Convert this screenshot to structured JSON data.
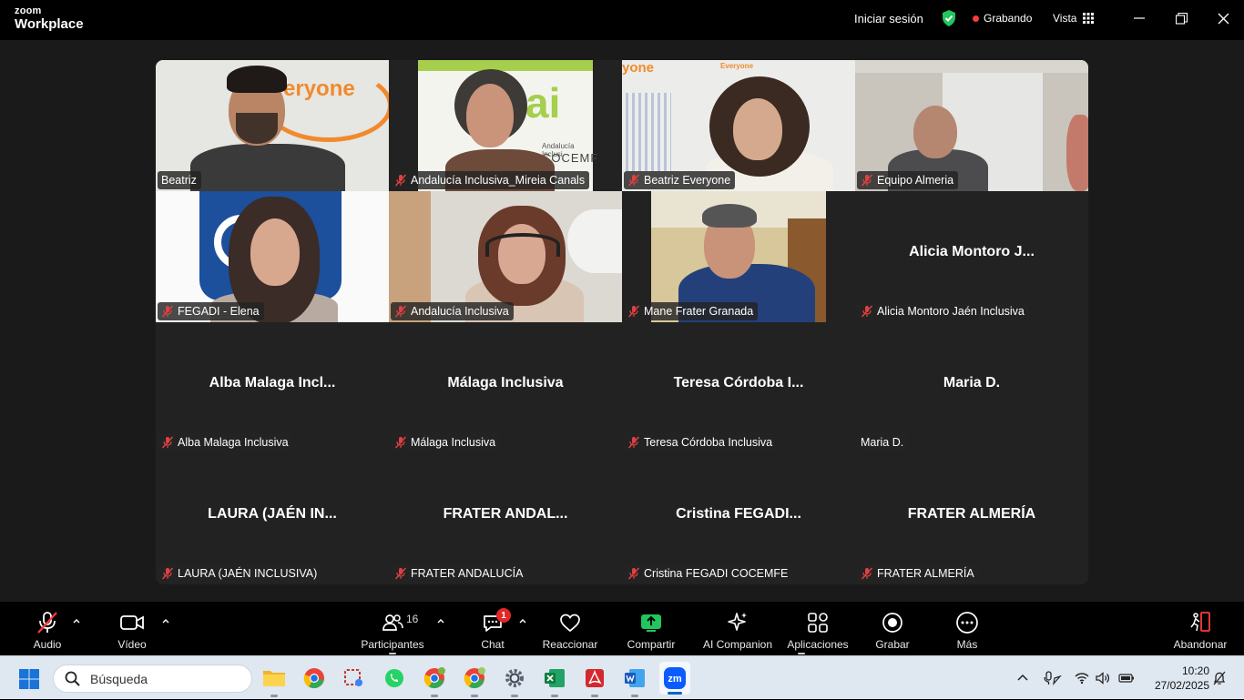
{
  "app": {
    "brand_small": "zoom",
    "brand_large": "Workplace",
    "signin": "Iniciar sesión",
    "recording": "Grabando",
    "view": "Vista"
  },
  "tiles": [
    {
      "name": "Beatriz",
      "big": "",
      "video": true,
      "muted": false,
      "active": true
    },
    {
      "name": "Andalucía Inclusiva_Mireia Canals",
      "big": "",
      "video": true,
      "muted": true
    },
    {
      "name": "Beatriz Everyone",
      "big": "",
      "video": true,
      "muted": true
    },
    {
      "name": "Equipo Almeria",
      "big": "",
      "video": true,
      "muted": true
    },
    {
      "name": "FEGADI - Elena",
      "big": "",
      "video": true,
      "muted": true
    },
    {
      "name": "Andalucía Inclusiva",
      "big": "",
      "video": true,
      "muted": true
    },
    {
      "name": "Mane Frater Granada",
      "big": "",
      "video": true,
      "muted": true
    },
    {
      "name": "Alicia Montoro Jaén Inclusiva",
      "big": "Alicia  Montoro  J...",
      "video": false,
      "muted": true
    },
    {
      "name": "Alba Malaga Inclusiva",
      "big": "Alba  Malaga  Incl...",
      "video": false,
      "muted": true
    },
    {
      "name": "Málaga Inclusiva",
      "big": "Málaga  Inclusiva",
      "video": false,
      "muted": true
    },
    {
      "name": "Teresa Córdoba Inclusiva",
      "big": "Teresa  Córdoba  I...",
      "video": false,
      "muted": true
    },
    {
      "name": "Maria D.",
      "big": "Maria  D.",
      "video": false,
      "muted": false
    },
    {
      "name": "LAURA (JAÉN INCLUSIVA)",
      "big": "LAURA  (JAÉN  IN...",
      "video": false,
      "muted": true
    },
    {
      "name": "FRATER ANDALUCÍA",
      "big": "FRATER  ANDAL...",
      "video": false,
      "muted": true
    },
    {
      "name": "Cristina FEGADI COCEMFE",
      "big": "Cristina  FEGADI...",
      "video": false,
      "muted": true
    },
    {
      "name": "FRATER ALMERÍA",
      "big": "FRATER ALMERÍA",
      "video": false,
      "muted": true
    }
  ],
  "video_labels": {
    "t0_logo": "eryone",
    "t1_logo": "ai",
    "t1_sub1": "Andalucía Inclusi",
    "t1_sub2": "COCEMF",
    "t2_logo": "yone",
    "t2_sub": "Everyone"
  },
  "toolbar": {
    "audio": "Audio",
    "video": "Vídeo",
    "participants": "Participantes",
    "participants_count": "16",
    "chat": "Chat",
    "chat_badge": "1",
    "react": "Reaccionar",
    "share": "Compartir",
    "ai": "AI Companion",
    "apps": "Aplicaciones",
    "record": "Grabar",
    "more": "Más",
    "leave": "Abandonar"
  },
  "taskbar": {
    "search_placeholder": "Búsqueda",
    "time": "10:20",
    "date": "27/02/2025"
  },
  "colors": {
    "active_speaker": "#2ee07a",
    "share_green": "#22c55e",
    "record_red": "#ff3b3b",
    "badge_red": "#e02828",
    "zoom_blue": "#0b5cff"
  }
}
